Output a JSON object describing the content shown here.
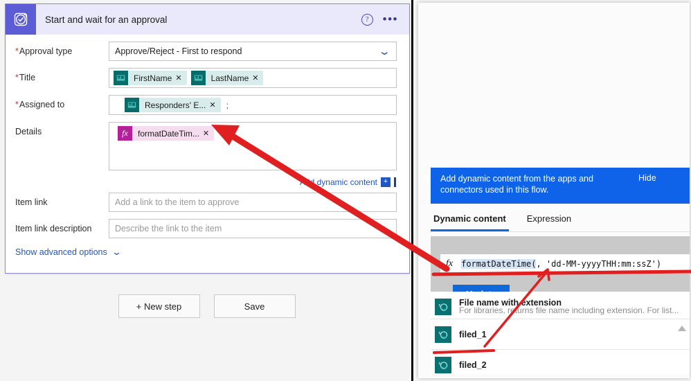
{
  "card": {
    "title": "Start and wait for an approval",
    "icon": "approval-checkmark-icon",
    "help_icon": "?",
    "menu_icon": "•••",
    "accent_color": "#5c5cd6",
    "header_bg": "#e9e9fb"
  },
  "form": {
    "rows": [
      {
        "label": "Approval type",
        "required": true,
        "kind": "dropdown",
        "value": "Approve/Reject - First to respond"
      },
      {
        "label": "Title",
        "required": true,
        "kind": "tokens",
        "tokens": [
          {
            "text": "FirstName",
            "type": "dynamic"
          },
          {
            "text": "LastName",
            "type": "dynamic"
          }
        ]
      },
      {
        "label": "Assigned to",
        "required": true,
        "kind": "tokens",
        "tokens": [
          {
            "text": "Responders' E...",
            "type": "dynamic"
          }
        ],
        "trailing": ";"
      },
      {
        "label": "Details",
        "required": false,
        "kind": "tokens-box",
        "tokens": [
          {
            "text": "formatDateTim...",
            "type": "expression"
          }
        ]
      },
      {
        "label": "Item link",
        "required": false,
        "kind": "placeholder",
        "placeholder": "Add a link to the item to approve"
      },
      {
        "label": "Item link description",
        "required": false,
        "kind": "placeholder",
        "placeholder": "Describe the link to the item"
      }
    ],
    "add_dynamic_content": "Add dynamic content",
    "add_dynamic_plus": "+",
    "show_advanced_options": "Show advanced options"
  },
  "buttons": {
    "new_step": "+ New step",
    "save": "Save"
  },
  "flyout": {
    "banner_text": "Add dynamic content from the apps and connectors used in this flow.",
    "banner_hide": "Hide",
    "banner_color": "#0e63e8",
    "tabs": [
      {
        "label": "Dynamic content",
        "active": true
      },
      {
        "label": "Expression",
        "active": false
      }
    ],
    "expression": {
      "fx_icon": "fx",
      "highlighted": "formatDateTime(",
      "rest": ", 'dd-MM-yyyyTHH:mm:ssZ')"
    },
    "update_button": "Update",
    "dynamic_items": [
      {
        "title": "File name with extension",
        "description": "For libraries, returns file name including extension. For list...",
        "icon": "sharepoint-icon"
      },
      {
        "title": "filed_1",
        "description": "",
        "icon": "sharepoint-icon"
      },
      {
        "title": "filed_2",
        "description": "",
        "icon": "sharepoint-icon"
      }
    ],
    "scroll_up_icon": "▲"
  },
  "annotations": {
    "color": "#e02020",
    "marks": [
      "big-arrow-from-expression-to-details-token",
      "thin-arrow-from-filed_1-to-expression-cursor",
      "horizontal-underline-expression",
      "horizontal-underline-filed_1"
    ]
  }
}
